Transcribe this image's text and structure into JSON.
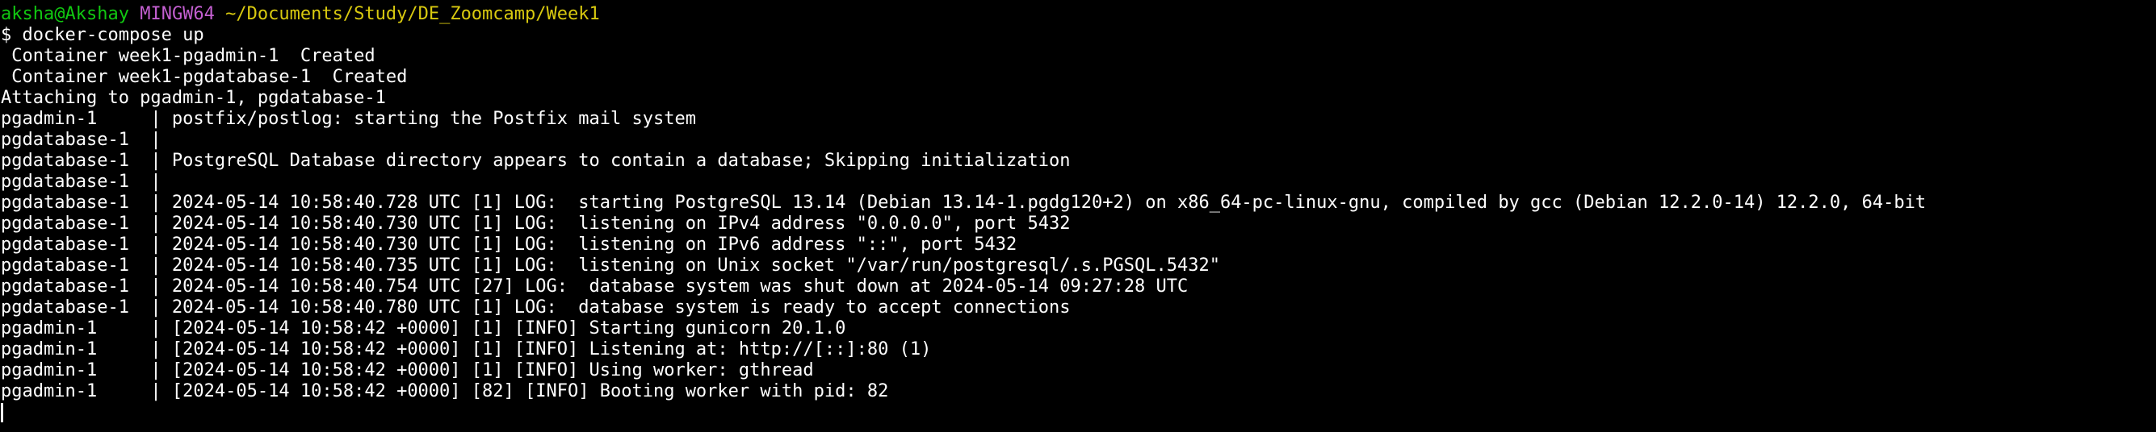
{
  "prompt": {
    "user_host": "aksha@Akshay",
    "env": "MINGW64",
    "cwd": "~/Documents/Study/DE_Zoomcamp/Week1"
  },
  "command": "$ docker-compose up",
  "colors": {
    "background": "#000000",
    "text": "#ffffff",
    "user_host": "#11c811",
    "env": "#c35fd0",
    "cwd": "#d8c90f"
  },
  "output_lines": [
    " Container week1-pgadmin-1  Created",
    " Container week1-pgdatabase-1  Created",
    "Attaching to pgadmin-1, pgdatabase-1",
    "pgadmin-1     | postfix/postlog: starting the Postfix mail system",
    "pgdatabase-1  | ",
    "pgdatabase-1  | PostgreSQL Database directory appears to contain a database; Skipping initialization",
    "pgdatabase-1  | ",
    "pgdatabase-1  | 2024-05-14 10:58:40.728 UTC [1] LOG:  starting PostgreSQL 13.14 (Debian 13.14-1.pgdg120+2) on x86_64-pc-linux-gnu, compiled by gcc (Debian 12.2.0-14) 12.2.0, 64-bit",
    "pgdatabase-1  | 2024-05-14 10:58:40.730 UTC [1] LOG:  listening on IPv4 address \"0.0.0.0\", port 5432",
    "pgdatabase-1  | 2024-05-14 10:58:40.730 UTC [1] LOG:  listening on IPv6 address \"::\", port 5432",
    "pgdatabase-1  | 2024-05-14 10:58:40.735 UTC [1] LOG:  listening on Unix socket \"/var/run/postgresql/.s.PGSQL.5432\"",
    "pgdatabase-1  | 2024-05-14 10:58:40.754 UTC [27] LOG:  database system was shut down at 2024-05-14 09:27:28 UTC",
    "pgdatabase-1  | 2024-05-14 10:58:40.780 UTC [1] LOG:  database system is ready to accept connections",
    "pgadmin-1     | [2024-05-14 10:58:42 +0000] [1] [INFO] Starting gunicorn 20.1.0",
    "pgadmin-1     | [2024-05-14 10:58:42 +0000] [1] [INFO] Listening at: http://[::]:80 (1)",
    "pgadmin-1     | [2024-05-14 10:58:42 +0000] [1] [INFO] Using worker: gthread",
    "pgadmin-1     | [2024-05-14 10:58:42 +0000] [82] [INFO] Booting worker with pid: 82"
  ]
}
